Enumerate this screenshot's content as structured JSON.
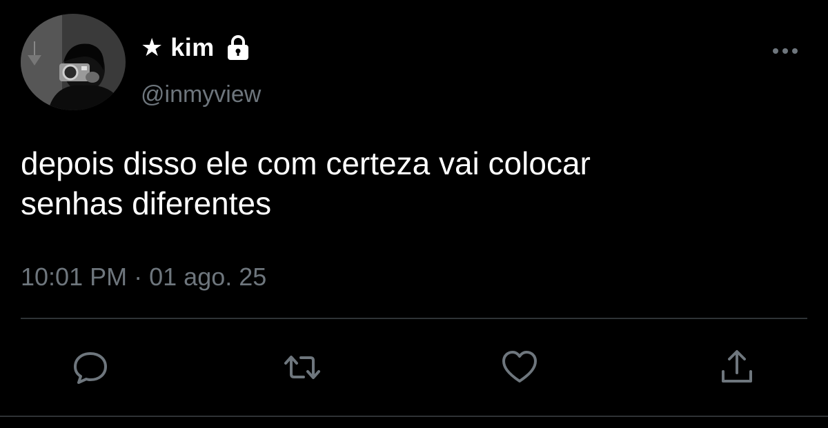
{
  "tweet": {
    "display_name": "★ kim",
    "handle": "@inmyview",
    "text": "depois disso ele com certeza vai colocar\nsenhas diferentes",
    "time": "10:01 PM",
    "separator": "·",
    "date": "01 ago. 25"
  },
  "icons": {
    "avatar": "profile-photo",
    "lock": "lock-icon",
    "more": "more-options-icon",
    "reply": "reply-icon",
    "retweet": "retweet-icon",
    "like": "heart-icon",
    "share": "share-icon"
  },
  "colors": {
    "background": "#000000",
    "text_primary": "#ffffff",
    "text_secondary": "#6e767d",
    "divider": "#2f3336"
  }
}
